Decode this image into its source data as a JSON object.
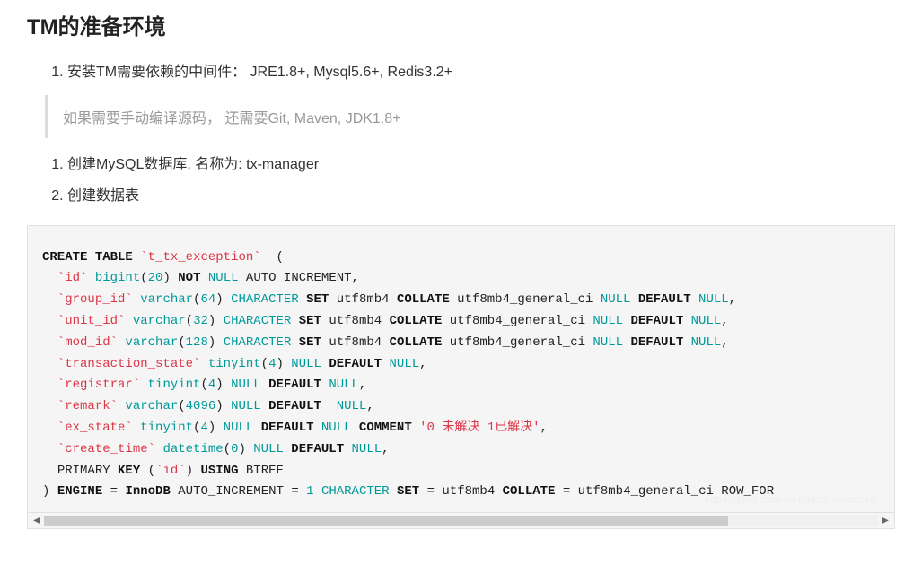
{
  "heading": "TM的准备环境",
  "list1": {
    "item1": "安装TM需要依赖的中间件： JRE1.8+, Mysql5.6+, Redis3.2+"
  },
  "blockquote": "如果需要手动编译源码， 还需要Git, Maven, JDK1.8+",
  "list2": {
    "item1": "创建MySQL数据库, 名称为: tx-manager",
    "item2": "创建数据表"
  },
  "sql": {
    "kw_create": "CREATE",
    "kw_table": "TABLE",
    "tbl_name": "`t_tx_exception`",
    "paren_open": "(",
    "col_id": "`id`",
    "ty_bigint": "bigint",
    "num_20": "20",
    "kw_not": "NOT",
    "kw_null": "NULL",
    "auto_inc": "AUTO_INCREMENT,",
    "col_group": "`group_id`",
    "ty_varchar": "varchar",
    "num_64": "64",
    "ty_character": "CHARACTER",
    "kw_set": "SET",
    "utf8mb4": "utf8mb4",
    "kw_collate": "COLLATE",
    "collation": "utf8mb4_general_ci",
    "kw_default": "DEFAULT",
    "comma": ",",
    "col_unit": "`unit_id`",
    "num_32": "32",
    "col_mod": "`mod_id`",
    "num_128": "128",
    "col_ts": "`transaction_state`",
    "ty_tinyint": "tinyint",
    "num_4": "4",
    "col_reg": "`registrar`",
    "col_remark": "`remark`",
    "num_4096": "4096",
    "col_ex": "`ex_state`",
    "kw_comment": "COMMENT",
    "str_comment": "'0 未解决 1已解决'",
    "col_ct": "`create_time`",
    "ty_datetime": "datetime",
    "num_0": "0",
    "primary": "PRIMARY",
    "kw_key": "KEY",
    "id_pk": "`id`",
    "kw_using": "USING",
    "btree": "BTREE",
    "paren_close": ")",
    "kw_engine": "ENGINE",
    "eq": "=",
    "innodb": "InnoDB",
    "autoinc2": "AUTO_INCREMENT",
    "num_1": "1",
    "rowfor": "ROW_FOR"
  },
  "watermark": "https://blog.csdn.net/daziyuanazhen",
  "scroll_left": "◀",
  "scroll_right": "▶",
  "space": " "
}
